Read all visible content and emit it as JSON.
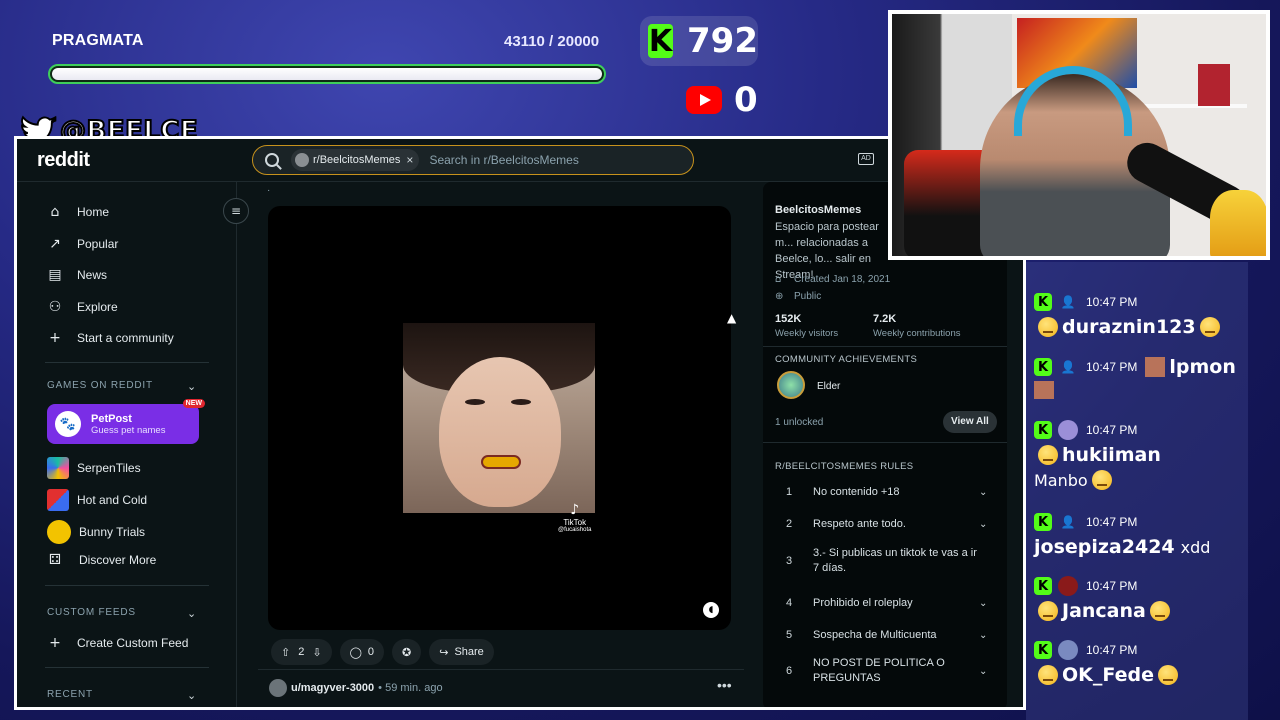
{
  "goal": {
    "title": "PRAGMATA",
    "count": "43110 / 20000",
    "progress": 1.0
  },
  "kick": {
    "count": "792",
    "logo": "K"
  },
  "youtube": {
    "count": "0"
  },
  "twitter": {
    "handle": "@BEELCE_"
  },
  "reddit": {
    "logo": "reddit",
    "search": {
      "chip_label": "r/BeelcitosMemes",
      "chip_close": "×",
      "placeholder": "Search in r/BeelcitosMemes"
    },
    "sidebar": {
      "nav": [
        {
          "label": "Home",
          "icon": "home-icon",
          "glyph": "⌂"
        },
        {
          "label": "Popular",
          "icon": "popular-icon",
          "glyph": "↗"
        },
        {
          "label": "News",
          "icon": "news-icon",
          "glyph": "▤"
        },
        {
          "label": "Explore",
          "icon": "explore-icon",
          "glyph": "⚇"
        },
        {
          "label": "Start a community",
          "icon": "plus-icon",
          "glyph": "+"
        }
      ],
      "games_heading": "GAMES ON REDDIT",
      "petpost": {
        "title": "PetPost",
        "subtitle": "Guess pet names",
        "badge": "NEW"
      },
      "games": [
        {
          "label": "SerpenTiles",
          "color": "#18c0a0"
        },
        {
          "label": "Hot and Cold",
          "color": "#3a6cf0"
        },
        {
          "label": "Bunny Trials",
          "color": "#f2c300"
        },
        {
          "label": "Discover More",
          "color": ""
        }
      ],
      "custom_feeds_heading": "CUSTOM FEEDS",
      "create_custom_feed": "Create Custom Feed",
      "recent_heading": "RECENT"
    },
    "post": {
      "dot": "·",
      "tiktok_label": "TikTok",
      "tiktok_handle": "@fucaishota",
      "votes": "2",
      "comments": "0",
      "share": "Share"
    },
    "next_post": {
      "user": "u/magyver-3000",
      "time": "• 59 min. ago"
    },
    "community": {
      "name": "BeelcitosMemes",
      "description": "Espacio para postear m... relacionadas a Beelce, lo... salir en Stream!",
      "created": "Created Jan 18, 2021",
      "visibility": "Public",
      "stats": [
        {
          "value": "152K",
          "label": "Weekly visitors"
        },
        {
          "value": "7.2K",
          "label": "Weekly contributions"
        }
      ],
      "achievements_heading": "COMMUNITY ACHIEVEMENTS",
      "achievement": "Elder",
      "unlocked": "1 unlocked",
      "view_all": "View All",
      "rules_heading": "R/BEELCITOSMEMES RULES",
      "rules": [
        {
          "num": "1",
          "text": "No contenido +18",
          "expandable": true
        },
        {
          "num": "2",
          "text": "Respeto ante todo.",
          "expandable": true
        },
        {
          "num": "3",
          "text": "3.- Si publicas un tiktok te vas a ir 7 días.",
          "expandable": false
        },
        {
          "num": "4",
          "text": "Prohibido el roleplay",
          "expandable": true
        },
        {
          "num": "5",
          "text": "Sospecha de Multicuenta",
          "expandable": true
        },
        {
          "num": "6",
          "text": "NO POST DE POLITICA O PREGUNTAS",
          "expandable": true
        }
      ]
    }
  },
  "chat": [
    {
      "time": "10:47 PM",
      "user": "duraznin123",
      "text": "",
      "pre_emoji": true,
      "post_emoji": true
    },
    {
      "time": "10:47 PM",
      "user": "lpmon",
      "text": "",
      "pre_emoji": false,
      "post_emoji": false
    },
    {
      "time": "10:47 PM",
      "user": "hukiiman",
      "text": "Manbo",
      "pre_emoji": true,
      "post_emoji": true
    },
    {
      "time": "10:47 PM",
      "user": "josepiza2424",
      "text": "xdd",
      "pre_emoji": false,
      "post_emoji": false
    },
    {
      "time": "10:47 PM",
      "user": "Jancana",
      "text": "",
      "pre_emoji": true,
      "post_emoji": true
    },
    {
      "time": "10:47 PM",
      "user": "OK_Fede",
      "text": "",
      "pre_emoji": true,
      "post_emoji": true
    }
  ]
}
